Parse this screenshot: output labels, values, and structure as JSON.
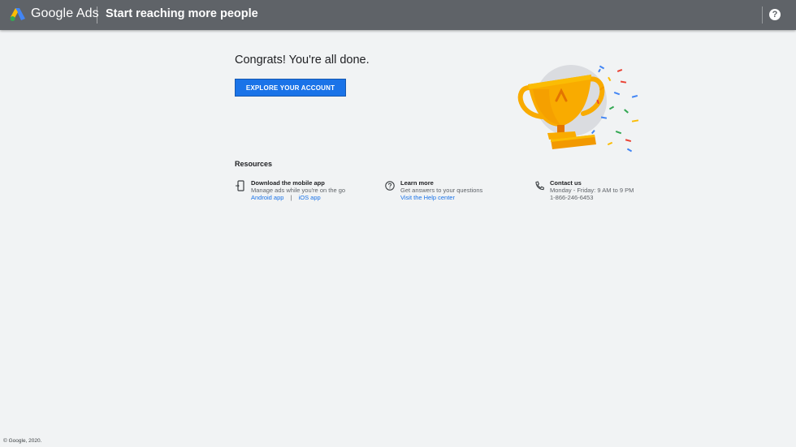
{
  "header": {
    "brand": "Google Ads",
    "title": "Start reaching more people",
    "help_icon": "help-icon",
    "help_glyph": "?"
  },
  "main": {
    "congrats": "Congrats! You're all done.",
    "explore_button": "EXPLORE YOUR ACCOUNT",
    "illustration": "trophy-illustration"
  },
  "resources": {
    "heading": "Resources",
    "items": [
      {
        "icon": "mobile-phone-icon",
        "title": "Download the mobile app",
        "subtitle": "Manage ads while you're on the go",
        "links": [
          "Android app",
          "iOS app"
        ],
        "separator": "|"
      },
      {
        "icon": "help-circle-icon",
        "title": "Learn more",
        "subtitle": "Get answers to your questions",
        "link": "Visit the Help center"
      },
      {
        "icon": "phone-icon",
        "title": "Contact us",
        "subtitle": "Monday - Friday: 9 AM to 9 PM",
        "detail": "1-866-246-6453"
      }
    ]
  },
  "footer": {
    "copyright": "© Google, 2020."
  },
  "colors": {
    "topbar": "#5f6368",
    "background": "#f1f3f4",
    "primary_button": "#1a73e8",
    "link": "#1a73e8",
    "trophy": "#f9ab00"
  }
}
